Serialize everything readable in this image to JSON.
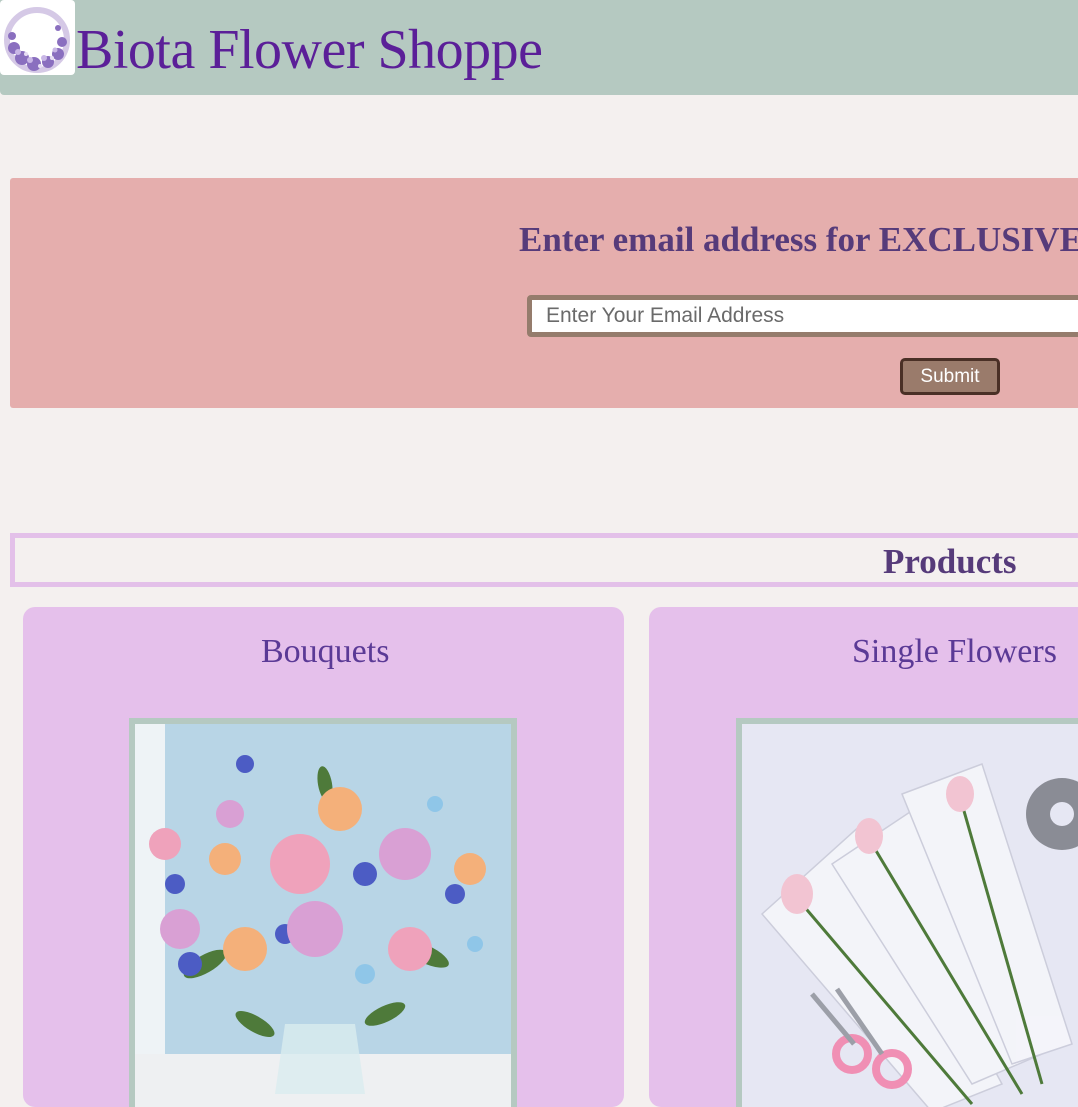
{
  "header": {
    "logo_icon": "floral-wreath-logo-icon",
    "title": "Biota Flower Shoppe",
    "background_color": "#b5c9c1",
    "title_color": "#5b1f98"
  },
  "promo": {
    "heading": "Enter email address for EXCLUSIVE",
    "email_placeholder": "Enter Your Email Address",
    "email_value": "",
    "submit_label": "Submit",
    "background_color": "#e5aead"
  },
  "products": {
    "heading": "Products",
    "cards": [
      {
        "title": "Bouquets",
        "image_icon": "bouquet-photo"
      },
      {
        "title": "Single Flowers",
        "image_icon": "wrapped-roses-photo"
      }
    ]
  },
  "colors": {
    "page_background": "#f4f0ef",
    "card_background": "#e5c0eb",
    "accent_purple": "#563b7a",
    "button_brown": "#9a7b6b"
  }
}
